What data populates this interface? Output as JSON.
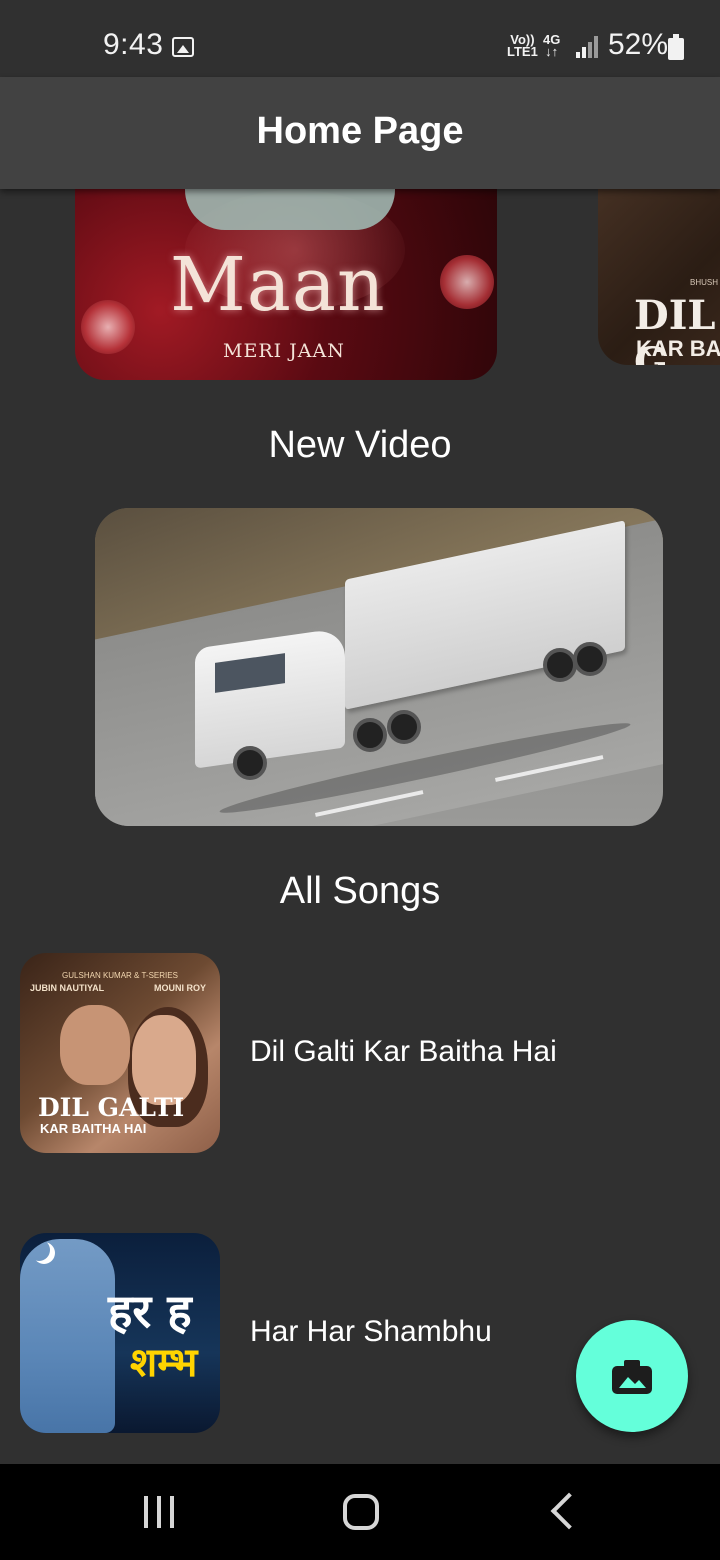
{
  "status_bar": {
    "time": "9:43",
    "volte_line1": "Vo))",
    "volte_line2": "LTE1",
    "network": "4G",
    "battery": "52%",
    "icons": [
      "gallery-icon",
      "signal-icon",
      "battery-charging-icon"
    ]
  },
  "app_bar": {
    "title": "Home Page"
  },
  "carousel": {
    "items": [
      {
        "title": "Maan",
        "subtitle": "MERI JAAN"
      },
      {
        "title": "DIL G",
        "subtitle": "KAR BA",
        "label": "BHUSH"
      }
    ]
  },
  "new_video": {
    "heading": "New Video"
  },
  "all_songs": {
    "heading": "All Songs",
    "items": [
      {
        "title": "Dil Galti Kar Baitha Hai",
        "thumb_top": "GULSHAN KUMAR & T-SERIES",
        "thumb_left": "JUBIN NAUTIYAL",
        "thumb_right": "MOUNI ROY",
        "thumb_title": "DIL GALTI",
        "thumb_subtitle": "KAR BAITHA HAI"
      },
      {
        "title": "Har Har Shambhu",
        "thumb_title": "हर ह",
        "thumb_subtitle": "शम्भ"
      }
    ]
  },
  "fab": {
    "icon": "add-photo-icon",
    "color": "#64ffda"
  },
  "nav_bar": {
    "icons": [
      "recent-apps-icon",
      "home-icon",
      "back-icon"
    ]
  },
  "colors": {
    "background": "#303030",
    "app_bar": "#424242",
    "accent": "#64ffda"
  }
}
